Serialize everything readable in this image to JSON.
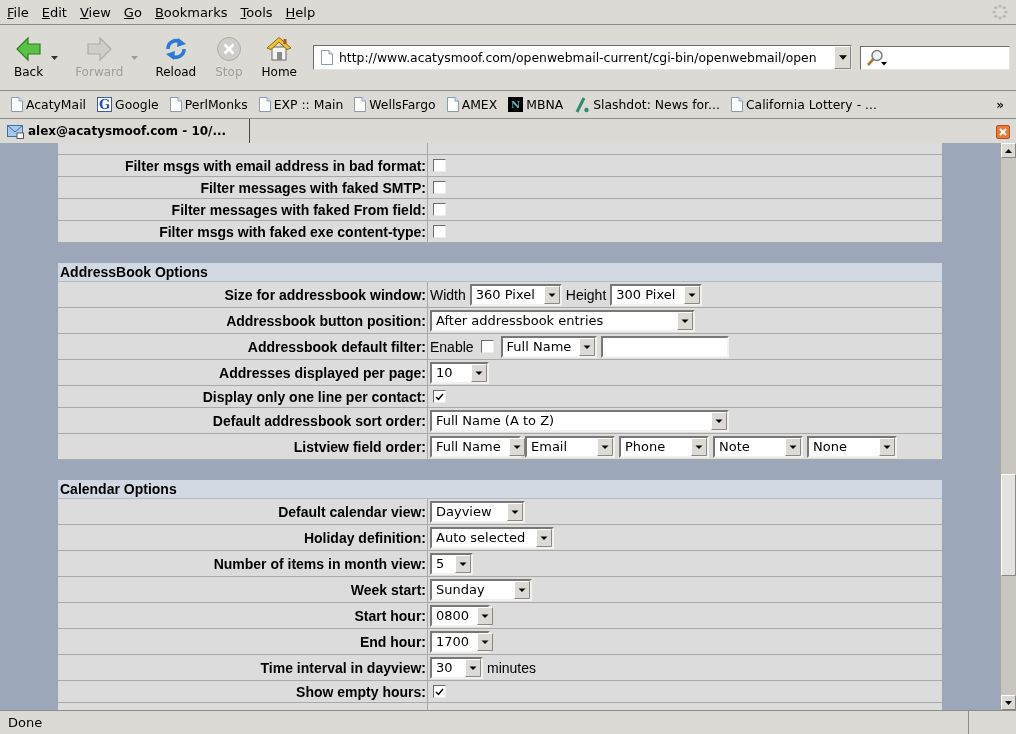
{
  "menu_bar": {
    "items": [
      "File",
      "Edit",
      "View",
      "Go",
      "Bookmarks",
      "Tools",
      "Help"
    ]
  },
  "toolbar": {
    "buttons": [
      {
        "label": "Back",
        "disabled": false,
        "dropdown": true
      },
      {
        "label": "Forward",
        "disabled": true,
        "dropdown": true
      },
      {
        "label": "Reload",
        "disabled": false,
        "dropdown": false
      },
      {
        "label": "Stop",
        "disabled": true,
        "dropdown": false
      },
      {
        "label": "Home",
        "disabled": false,
        "dropdown": false
      }
    ],
    "address": "http://www.acatysmoof.com/openwebmail-current/cgi-bin/openwebmail/open"
  },
  "bookmarks": {
    "items": [
      {
        "label": "AcatyMail",
        "kind": "page"
      },
      {
        "label": "Google",
        "kind": "tile",
        "letter": "G"
      },
      {
        "label": "PerlMonks",
        "kind": "page"
      },
      {
        "label": "EXP :: Main",
        "kind": "page"
      },
      {
        "label": "WellsFargo",
        "kind": "page"
      },
      {
        "label": "AMEX",
        "kind": "page"
      },
      {
        "label": "MBNA",
        "kind": "darktile",
        "letter": "N"
      },
      {
        "label": "Slashdot: News for...",
        "kind": "slash"
      },
      {
        "label": "California Lottery - ...",
        "kind": "page"
      }
    ],
    "overflow": "»"
  },
  "tabs": [
    {
      "title": "alex@acatysmoof.com - 10/...",
      "selected": true
    }
  ],
  "sections": [
    {
      "rows": [
        {
          "label": "Filter msgs with email address in bad format:",
          "controls": [
            {
              "kind": "checkbox",
              "checked": false
            }
          ]
        },
        {
          "label": "Filter messages with faked SMTP:",
          "controls": [
            {
              "kind": "checkbox",
              "checked": false
            }
          ]
        },
        {
          "label": "Filter messages with faked From field:",
          "controls": [
            {
              "kind": "checkbox",
              "checked": false
            }
          ]
        },
        {
          "label": "Filter msgs with faked exe content-type:",
          "controls": [
            {
              "kind": "checkbox",
              "checked": false
            }
          ]
        }
      ]
    },
    {
      "title": "AddressBook Options",
      "rows": [
        {
          "label": "Size for addressbook window:",
          "controls": [
            {
              "kind": "text",
              "value": "Width"
            },
            {
              "kind": "select",
              "value": "360 Pixel"
            },
            {
              "kind": "text",
              "value": "Height"
            },
            {
              "kind": "select",
              "value": "300 Pixel"
            }
          ]
        },
        {
          "label": "Addressbook button position:",
          "controls": [
            {
              "kind": "select",
              "value": "After addressbook entries"
            }
          ]
        },
        {
          "label": "Addressbook default filter:",
          "controls": [
            {
              "kind": "text",
              "value": "Enable"
            },
            {
              "kind": "checkbox",
              "checked": false
            },
            {
              "kind": "select",
              "value": "Full Name"
            },
            {
              "kind": "input"
            }
          ]
        },
        {
          "label": "Addresses displayed per page:",
          "controls": [
            {
              "kind": "select",
              "value": "10"
            }
          ]
        },
        {
          "label": "Display only one line per contact:",
          "controls": [
            {
              "kind": "checkbox",
              "checked": true
            }
          ]
        },
        {
          "label": "Default addressbook sort order:",
          "controls": [
            {
              "kind": "select",
              "value": "Full Name (A to Z)"
            }
          ]
        },
        {
          "label": "Listview field order:",
          "controls": [
            {
              "kind": "select",
              "value": "Full Name"
            },
            {
              "kind": "select",
              "value": "Email"
            },
            {
              "kind": "select",
              "value": "Phone"
            },
            {
              "kind": "select",
              "value": "Note"
            },
            {
              "kind": "select",
              "value": "None"
            }
          ]
        }
      ]
    },
    {
      "title": "Calendar Options",
      "rows": [
        {
          "label": "Default calendar view:",
          "controls": [
            {
              "kind": "select",
              "value": "Dayview"
            }
          ]
        },
        {
          "label": "Holiday definition:",
          "controls": [
            {
              "kind": "select",
              "value": "Auto selected"
            }
          ]
        },
        {
          "label": "Number of items in month view:",
          "controls": [
            {
              "kind": "select",
              "value": "5"
            }
          ]
        },
        {
          "label": "Week start:",
          "controls": [
            {
              "kind": "select",
              "value": "Sunday"
            }
          ]
        },
        {
          "label": "Start hour:",
          "controls": [
            {
              "kind": "select",
              "value": "0800"
            }
          ]
        },
        {
          "label": "End hour:",
          "controls": [
            {
              "kind": "select",
              "value": "1700"
            }
          ]
        },
        {
          "label": "Time interval in dayview:",
          "controls": [
            {
              "kind": "select",
              "value": "30"
            },
            {
              "kind": "text",
              "value": "minutes"
            }
          ]
        },
        {
          "label": "Show empty hours:",
          "controls": [
            {
              "kind": "checkbox",
              "checked": true
            }
          ]
        }
      ]
    }
  ],
  "status_bar": {
    "text": "Done"
  }
}
